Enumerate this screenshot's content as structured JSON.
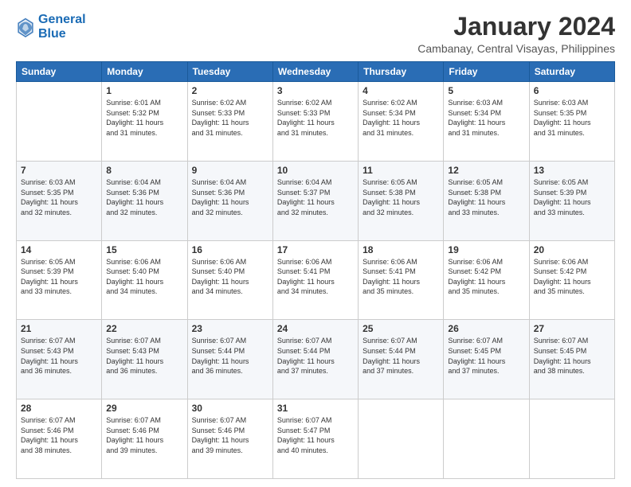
{
  "logo": {
    "line1": "General",
    "line2": "Blue"
  },
  "title": "January 2024",
  "location": "Cambanay, Central Visayas, Philippines",
  "headers": [
    "Sunday",
    "Monday",
    "Tuesday",
    "Wednesday",
    "Thursday",
    "Friday",
    "Saturday"
  ],
  "weeks": [
    [
      {
        "day": "",
        "info": ""
      },
      {
        "day": "1",
        "info": "Sunrise: 6:01 AM\nSunset: 5:32 PM\nDaylight: 11 hours\nand 31 minutes."
      },
      {
        "day": "2",
        "info": "Sunrise: 6:02 AM\nSunset: 5:33 PM\nDaylight: 11 hours\nand 31 minutes."
      },
      {
        "day": "3",
        "info": "Sunrise: 6:02 AM\nSunset: 5:33 PM\nDaylight: 11 hours\nand 31 minutes."
      },
      {
        "day": "4",
        "info": "Sunrise: 6:02 AM\nSunset: 5:34 PM\nDaylight: 11 hours\nand 31 minutes."
      },
      {
        "day": "5",
        "info": "Sunrise: 6:03 AM\nSunset: 5:34 PM\nDaylight: 11 hours\nand 31 minutes."
      },
      {
        "day": "6",
        "info": "Sunrise: 6:03 AM\nSunset: 5:35 PM\nDaylight: 11 hours\nand 31 minutes."
      }
    ],
    [
      {
        "day": "7",
        "info": "Sunrise: 6:03 AM\nSunset: 5:35 PM\nDaylight: 11 hours\nand 32 minutes."
      },
      {
        "day": "8",
        "info": "Sunrise: 6:04 AM\nSunset: 5:36 PM\nDaylight: 11 hours\nand 32 minutes."
      },
      {
        "day": "9",
        "info": "Sunrise: 6:04 AM\nSunset: 5:36 PM\nDaylight: 11 hours\nand 32 minutes."
      },
      {
        "day": "10",
        "info": "Sunrise: 6:04 AM\nSunset: 5:37 PM\nDaylight: 11 hours\nand 32 minutes."
      },
      {
        "day": "11",
        "info": "Sunrise: 6:05 AM\nSunset: 5:38 PM\nDaylight: 11 hours\nand 32 minutes."
      },
      {
        "day": "12",
        "info": "Sunrise: 6:05 AM\nSunset: 5:38 PM\nDaylight: 11 hours\nand 33 minutes."
      },
      {
        "day": "13",
        "info": "Sunrise: 6:05 AM\nSunset: 5:39 PM\nDaylight: 11 hours\nand 33 minutes."
      }
    ],
    [
      {
        "day": "14",
        "info": "Sunrise: 6:05 AM\nSunset: 5:39 PM\nDaylight: 11 hours\nand 33 minutes."
      },
      {
        "day": "15",
        "info": "Sunrise: 6:06 AM\nSunset: 5:40 PM\nDaylight: 11 hours\nand 34 minutes."
      },
      {
        "day": "16",
        "info": "Sunrise: 6:06 AM\nSunset: 5:40 PM\nDaylight: 11 hours\nand 34 minutes."
      },
      {
        "day": "17",
        "info": "Sunrise: 6:06 AM\nSunset: 5:41 PM\nDaylight: 11 hours\nand 34 minutes."
      },
      {
        "day": "18",
        "info": "Sunrise: 6:06 AM\nSunset: 5:41 PM\nDaylight: 11 hours\nand 35 minutes."
      },
      {
        "day": "19",
        "info": "Sunrise: 6:06 AM\nSunset: 5:42 PM\nDaylight: 11 hours\nand 35 minutes."
      },
      {
        "day": "20",
        "info": "Sunrise: 6:06 AM\nSunset: 5:42 PM\nDaylight: 11 hours\nand 35 minutes."
      }
    ],
    [
      {
        "day": "21",
        "info": "Sunrise: 6:07 AM\nSunset: 5:43 PM\nDaylight: 11 hours\nand 36 minutes."
      },
      {
        "day": "22",
        "info": "Sunrise: 6:07 AM\nSunset: 5:43 PM\nDaylight: 11 hours\nand 36 minutes."
      },
      {
        "day": "23",
        "info": "Sunrise: 6:07 AM\nSunset: 5:44 PM\nDaylight: 11 hours\nand 36 minutes."
      },
      {
        "day": "24",
        "info": "Sunrise: 6:07 AM\nSunset: 5:44 PM\nDaylight: 11 hours\nand 37 minutes."
      },
      {
        "day": "25",
        "info": "Sunrise: 6:07 AM\nSunset: 5:44 PM\nDaylight: 11 hours\nand 37 minutes."
      },
      {
        "day": "26",
        "info": "Sunrise: 6:07 AM\nSunset: 5:45 PM\nDaylight: 11 hours\nand 37 minutes."
      },
      {
        "day": "27",
        "info": "Sunrise: 6:07 AM\nSunset: 5:45 PM\nDaylight: 11 hours\nand 38 minutes."
      }
    ],
    [
      {
        "day": "28",
        "info": "Sunrise: 6:07 AM\nSunset: 5:46 PM\nDaylight: 11 hours\nand 38 minutes."
      },
      {
        "day": "29",
        "info": "Sunrise: 6:07 AM\nSunset: 5:46 PM\nDaylight: 11 hours\nand 39 minutes."
      },
      {
        "day": "30",
        "info": "Sunrise: 6:07 AM\nSunset: 5:46 PM\nDaylight: 11 hours\nand 39 minutes."
      },
      {
        "day": "31",
        "info": "Sunrise: 6:07 AM\nSunset: 5:47 PM\nDaylight: 11 hours\nand 40 minutes."
      },
      {
        "day": "",
        "info": ""
      },
      {
        "day": "",
        "info": ""
      },
      {
        "day": "",
        "info": ""
      }
    ]
  ]
}
